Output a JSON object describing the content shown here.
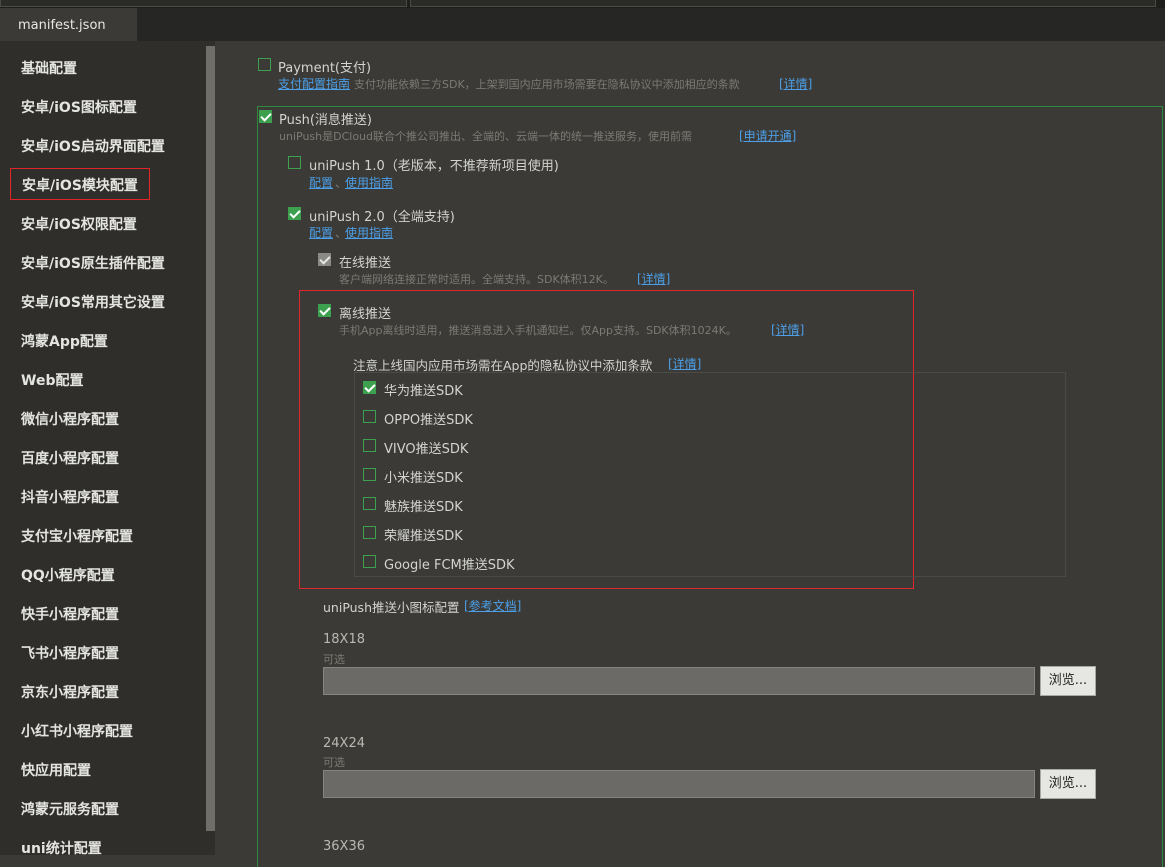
{
  "tab": {
    "title": "manifest.json"
  },
  "sidebar": {
    "items": [
      "基础配置",
      "安卓/iOS图标配置",
      "安卓/iOS启动界面配置",
      "安卓/iOS模块配置",
      "安卓/iOS权限配置",
      "安卓/iOS原生插件配置",
      "安卓/iOS常用其它设置",
      "鸿蒙App配置",
      "Web配置",
      "微信小程序配置",
      "百度小程序配置",
      "抖音小程序配置",
      "支付宝小程序配置",
      "QQ小程序配置",
      "快手小程序配置",
      "飞书小程序配置",
      "京东小程序配置",
      "小红书小程序配置",
      "快应用配置",
      "鸿蒙元服务配置",
      "uni统计配置"
    ],
    "active_index": 3
  },
  "payment": {
    "label": "Payment(支付)",
    "guide_link": "支付配置指南",
    "desc": "支付功能依赖三方SDK，上架到国内应用市场需要在隐私协议中添加相应的条款",
    "detail_link": "[详情]",
    "checked": false
  },
  "push": {
    "label": "Push(消息推送)",
    "desc": "uniPush是DCloud联合个推公司推出、全端的、云端一体的统一推送服务，使用前需",
    "apply_link": "[申请开通]",
    "checked": true
  },
  "unipush1": {
    "label": "uniPush 1.0（老版本，不推荐新项目使用)",
    "config_link": "配置",
    "sep": "、",
    "guide_link": "使用指南",
    "checked": false
  },
  "unipush2": {
    "label": "uniPush 2.0（全端支持)",
    "config_link": "配置",
    "sep": "、",
    "guide_link": "使用指南",
    "checked": true
  },
  "online": {
    "label": "在线推送",
    "desc": "客户端网络连接正常时适用。全端支持。SDK体积12K。",
    "detail_link": "[详情]"
  },
  "offline": {
    "label": "离线推送",
    "desc": "手机App离线时适用，推送消息进入手机通知栏。仅App支持。SDK体积1024K。",
    "detail_link": "[详情]",
    "checked": true
  },
  "notice": {
    "text": "注意上线国内应用市场需在App的隐私协议中添加条款",
    "link": "[详情]"
  },
  "sdks": [
    {
      "label": "华为推送SDK",
      "checked": true
    },
    {
      "label": "OPPO推送SDK",
      "checked": false
    },
    {
      "label": "VIVO推送SDK",
      "checked": false
    },
    {
      "label": "小米推送SDK",
      "checked": false
    },
    {
      "label": "魅族推送SDK",
      "checked": false
    },
    {
      "label": "荣耀推送SDK",
      "checked": false
    },
    {
      "label": "Google FCM推送SDK",
      "checked": false
    }
  ],
  "icon_config": {
    "title": "uniPush推送小图标配置",
    "doc_link": "[参考文档]",
    "optional": "可选",
    "browse": "浏览...",
    "sizes": [
      "18X18",
      "24X24",
      "36X36"
    ]
  },
  "colors": {
    "accent_green": "#3ca04f",
    "link_blue": "#4c9fe8",
    "highlight_red": "#e0262b"
  }
}
